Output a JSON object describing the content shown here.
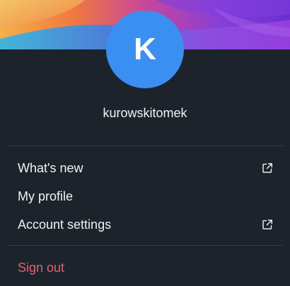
{
  "user": {
    "initial": "K",
    "username": "kurowskitomek"
  },
  "menu": {
    "items": [
      {
        "label": "What's new",
        "icon": "external-link-icon"
      },
      {
        "label": "My profile"
      },
      {
        "label": "Account settings",
        "icon": "external-link-icon"
      }
    ],
    "sign_out_label": "Sign out"
  },
  "colors": {
    "background": "#1c232b",
    "avatar": "#3b8ff0",
    "danger": "#e5606d",
    "divider": "#343c46"
  }
}
